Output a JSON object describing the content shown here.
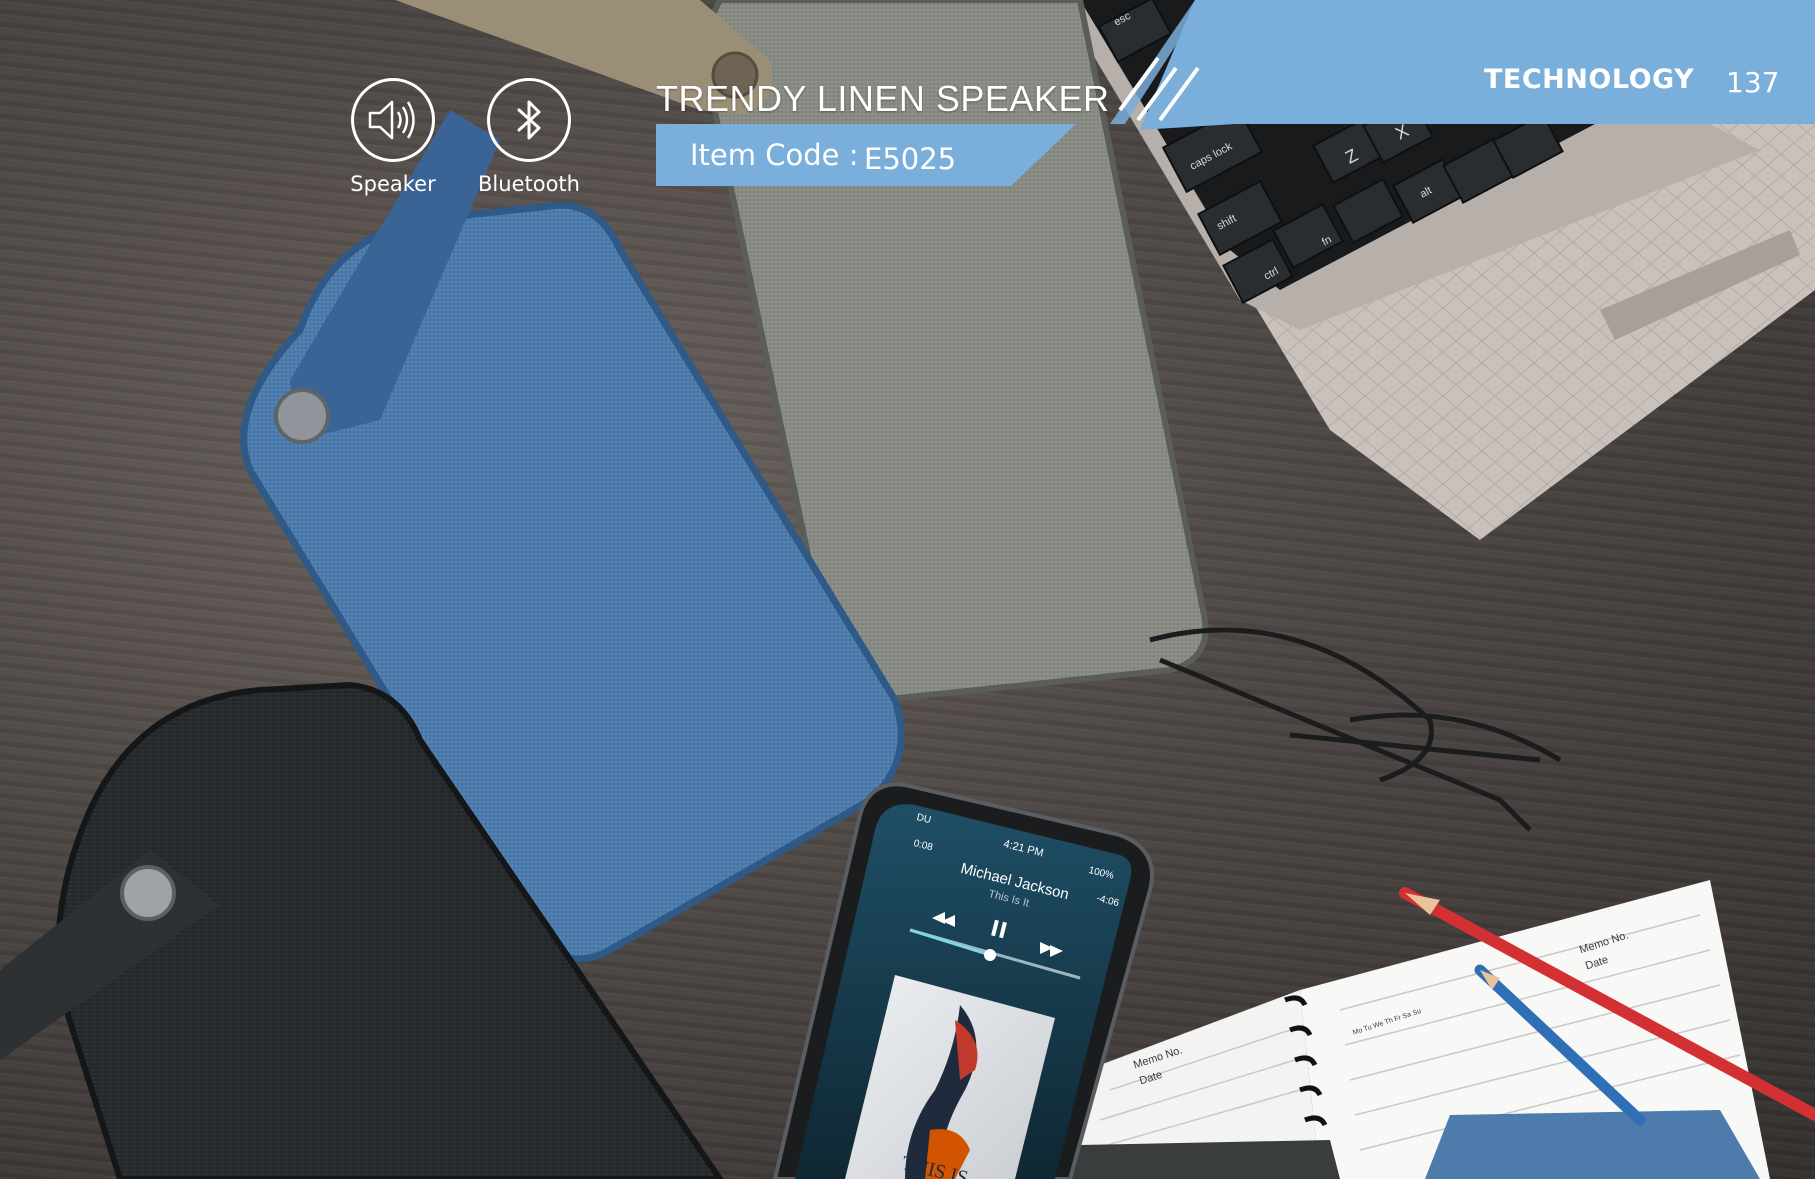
{
  "header": {
    "title": "TRENDY LINEN SPEAKER",
    "item_code_label": "Item Code :",
    "item_code_value": "E5025",
    "section": "TECHNOLOGY",
    "page_number": "137"
  },
  "features": [
    {
      "label": "Speaker",
      "icon": "speaker-icon"
    },
    {
      "label": "Bluetooth",
      "icon": "bluetooth-icon"
    }
  ],
  "phone_screen": {
    "status_left": "DU",
    "time": "4:21 PM",
    "battery": "100%",
    "elapsed": "0:08",
    "remaining": "-4:06",
    "artist": "Michael Jackson",
    "song": "This Is It",
    "album_art_text": "THIS IS"
  },
  "keyboard": {
    "keys": [
      "esc",
      "caps lock",
      "shift",
      "fn",
      "ctrl",
      "alt",
      "Z",
      "X"
    ]
  },
  "notebook": {
    "memo_left": "Memo No.",
    "date_left": "Date",
    "memo_right": "Memo No.",
    "date_right": "Date",
    "weekdays": [
      "Mo",
      "Tu",
      "We",
      "Th",
      "Fr",
      "Sa",
      "Su"
    ]
  },
  "colors": {
    "banner_blue": "#7aaedb",
    "white": "#ffffff",
    "wood": "#4c4643",
    "blue_speaker": "#4a78a8",
    "grey_speaker": "#8b8d86",
    "black_speaker": "#262827"
  }
}
